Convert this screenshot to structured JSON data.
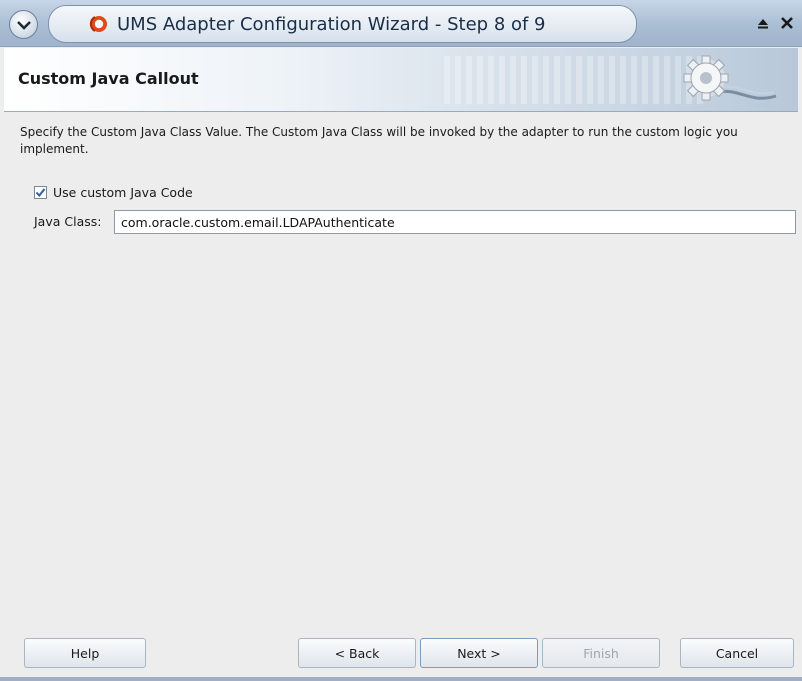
{
  "window": {
    "title": "UMS Adapter Configuration Wizard - Step 8 of 9"
  },
  "banner": {
    "title": "Custom Java Callout"
  },
  "content": {
    "description": "Specify the Custom Java Class Value. The Custom Java Class will be invoked by the adapter to run the custom logic you implement.",
    "checkbox_label": "Use custom Java Code",
    "checkbox_checked": true,
    "java_class_label": "Java Class:",
    "java_class_value": "com.oracle.custom.email.LDAPAuthenticate"
  },
  "buttons": {
    "help": "Help",
    "back": "< Back",
    "next": "Next >",
    "finish": "Finish",
    "cancel": "Cancel"
  },
  "icons": {
    "window_menu": "chevron-down-icon",
    "app": "oracle-logo-icon",
    "maximize": "maximize-icon",
    "close": "close-icon",
    "banner": "gear-plug-icon"
  }
}
